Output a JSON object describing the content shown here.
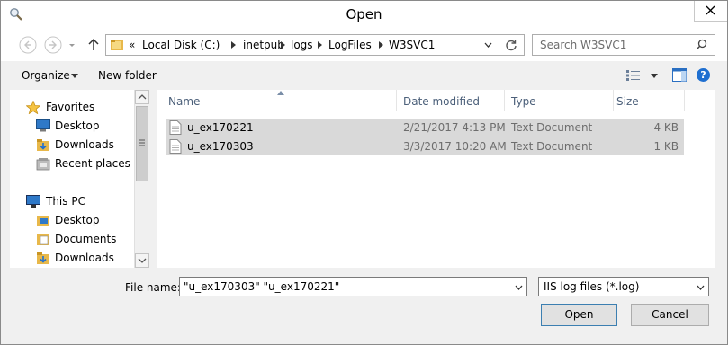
{
  "window": {
    "title": "Open"
  },
  "address": {
    "overflow": "«",
    "crumbs": [
      "Local Disk (C:)",
      "inetpub",
      "logs",
      "LogFiles",
      "W3SVC1"
    ]
  },
  "search": {
    "placeholder": "Search W3SVC1"
  },
  "toolbar": {
    "organize": "Organize",
    "new_folder": "New folder"
  },
  "nav": {
    "favorites": {
      "label": "Favorites",
      "icon": "star-icon"
    },
    "favorites_items": [
      {
        "label": "Desktop",
        "icon": "desktop-icon"
      },
      {
        "label": "Downloads",
        "icon": "downloads-icon"
      },
      {
        "label": "Recent places",
        "icon": "recent-places-icon"
      }
    ],
    "this_pc": {
      "label": "This PC",
      "icon": "computer-icon"
    },
    "pc_items": [
      {
        "label": "Desktop",
        "icon": "desktop-folder-icon"
      },
      {
        "label": "Documents",
        "icon": "documents-icon"
      },
      {
        "label": "Downloads",
        "icon": "downloads-icon"
      }
    ]
  },
  "columns": {
    "name": "Name",
    "date": "Date modified",
    "type": "Type",
    "size": "Size"
  },
  "files": [
    {
      "name": "u_ex170221",
      "date": "2/21/2017 4:13 PM",
      "type": "Text Document",
      "size": "4 KB"
    },
    {
      "name": "u_ex170303",
      "date": "3/3/2017 10:20 AM",
      "type": "Text Document",
      "size": "1 KB"
    }
  ],
  "footer": {
    "file_name_label": "File name:",
    "file_name_value": "\"u_ex170303\" \"u_ex170221\"",
    "file_type": "IIS log files (*.log)",
    "open": "Open",
    "cancel": "Cancel"
  },
  "colors": {
    "selected_row": "#d9d9d9",
    "header_text": "#4c607a",
    "accent": "#1f6fd0"
  }
}
